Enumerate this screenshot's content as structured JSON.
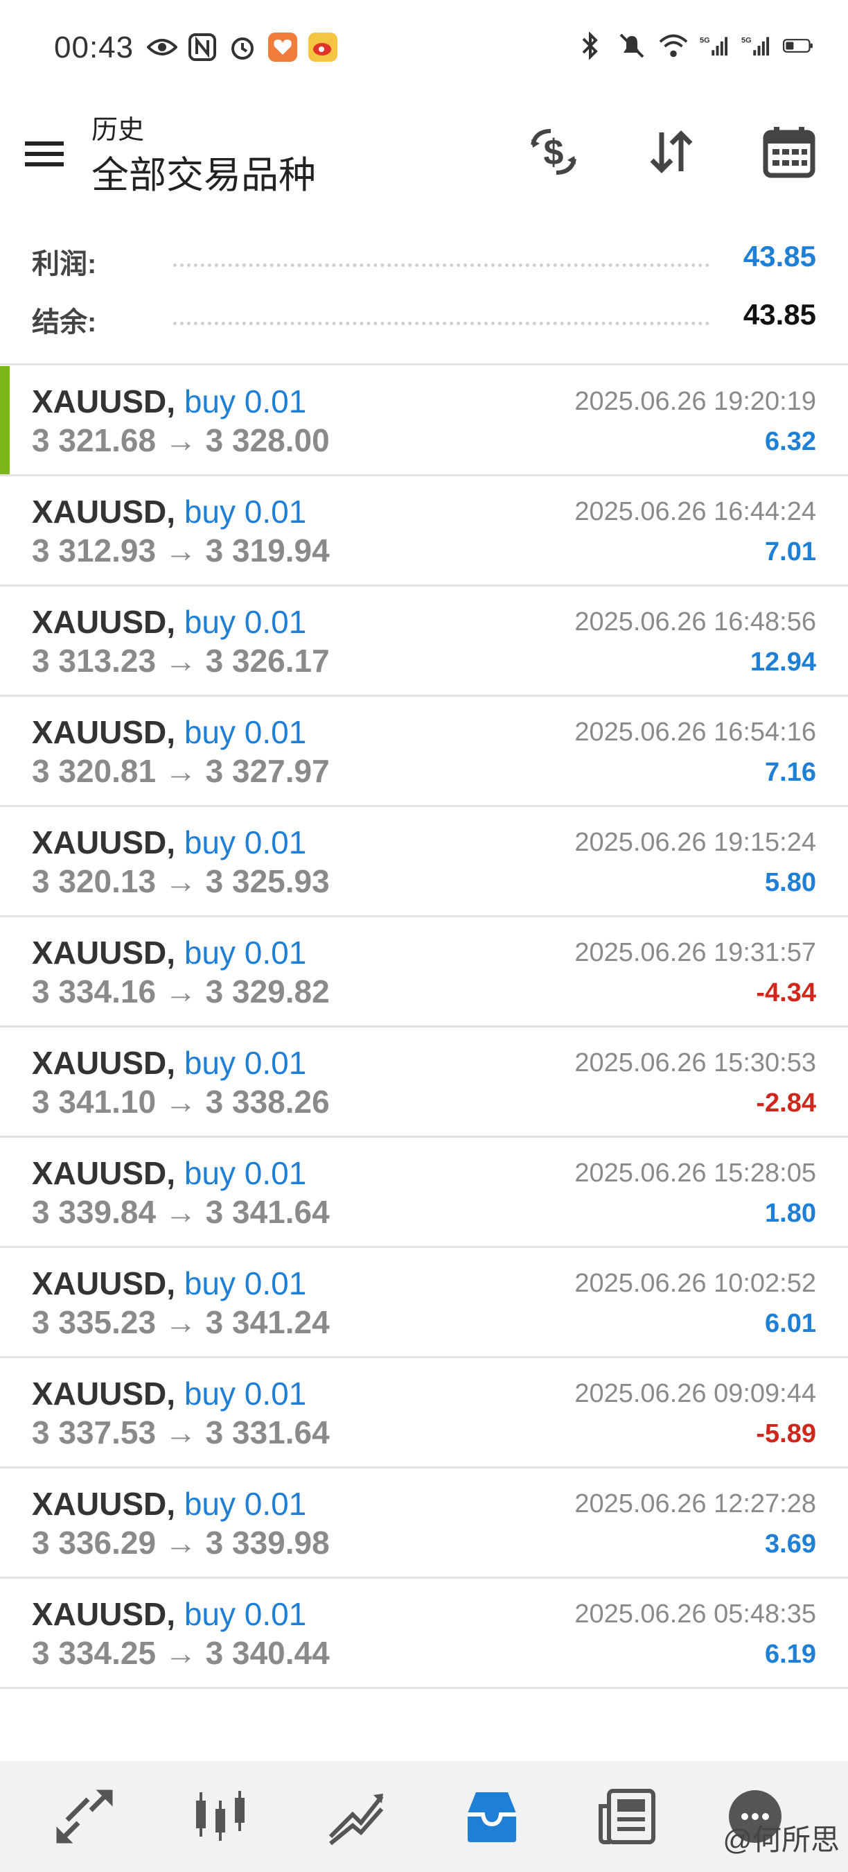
{
  "status_bar": {
    "time": "00:43",
    "left_icons": [
      "eye-icon",
      "nfc-icon",
      "alarm-icon",
      "heart-app-icon",
      "weibo-app-icon"
    ],
    "right_icons": [
      "bluetooth-icon",
      "mute-bell-icon",
      "wifi-icon",
      "5g-signal-icon",
      "5g-signal-icon",
      "battery-icon"
    ]
  },
  "header": {
    "subtitle": "历史",
    "title": "全部交易品种",
    "actions": [
      "currency-exchange-icon",
      "sort-icon",
      "calendar-icon"
    ]
  },
  "summary": {
    "profit_label": "利润:",
    "profit_value": "43.85",
    "balance_label": "结余:",
    "balance_value": "43.85"
  },
  "trades": [
    {
      "symbol": "XAUUSD,",
      "side": "buy 0.01",
      "prices": "3 321.68 → 3 328.00",
      "time": "2025.06.26 19:20:19",
      "profit": "6.32",
      "sign": "pos"
    },
    {
      "symbol": "XAUUSD,",
      "side": "buy 0.01",
      "prices": "3 312.93 → 3 319.94",
      "time": "2025.06.26 16:44:24",
      "profit": "7.01",
      "sign": "pos"
    },
    {
      "symbol": "XAUUSD,",
      "side": "buy 0.01",
      "prices": "3 313.23 → 3 326.17",
      "time": "2025.06.26 16:48:56",
      "profit": "12.94",
      "sign": "pos"
    },
    {
      "symbol": "XAUUSD,",
      "side": "buy 0.01",
      "prices": "3 320.81 → 3 327.97",
      "time": "2025.06.26 16:54:16",
      "profit": "7.16",
      "sign": "pos"
    },
    {
      "symbol": "XAUUSD,",
      "side": "buy 0.01",
      "prices": "3 320.13 → 3 325.93",
      "time": "2025.06.26 19:15:24",
      "profit": "5.80",
      "sign": "pos"
    },
    {
      "symbol": "XAUUSD,",
      "side": "buy 0.01",
      "prices": "3 334.16 → 3 329.82",
      "time": "2025.06.26 19:31:57",
      "profit": "-4.34",
      "sign": "neg"
    },
    {
      "symbol": "XAUUSD,",
      "side": "buy 0.01",
      "prices": "3 341.10 → 3 338.26",
      "time": "2025.06.26 15:30:53",
      "profit": "-2.84",
      "sign": "neg"
    },
    {
      "symbol": "XAUUSD,",
      "side": "buy 0.01",
      "prices": "3 339.84 → 3 341.64",
      "time": "2025.06.26 15:28:05",
      "profit": "1.80",
      "sign": "pos"
    },
    {
      "symbol": "XAUUSD,",
      "side": "buy 0.01",
      "prices": "3 335.23 → 3 341.24",
      "time": "2025.06.26 10:02:52",
      "profit": "6.01",
      "sign": "pos"
    },
    {
      "symbol": "XAUUSD,",
      "side": "buy 0.01",
      "prices": "3 337.53 → 3 331.64",
      "time": "2025.06.26 09:09:44",
      "profit": "-5.89",
      "sign": "neg"
    },
    {
      "symbol": "XAUUSD,",
      "side": "buy 0.01",
      "prices": "3 336.29 → 3 339.98",
      "time": "2025.06.26 12:27:28",
      "profit": "3.69",
      "sign": "pos"
    },
    {
      "symbol": "XAUUSD,",
      "side": "buy 0.01",
      "prices": "3 334.25 → 3 340.44",
      "time": "2025.06.26 05:48:35",
      "profit": "6.19",
      "sign": "pos"
    }
  ],
  "bottom_nav": {
    "items": [
      "quotes-icon",
      "chart-icon",
      "trade-icon",
      "history-icon",
      "news-icon",
      "chat-icon"
    ],
    "active": "history-icon",
    "watermark": "@何所思"
  },
  "colors": {
    "accent_blue": "#1e7fd6",
    "loss_red": "#d0271d",
    "active_bar_green": "#7cb518"
  }
}
